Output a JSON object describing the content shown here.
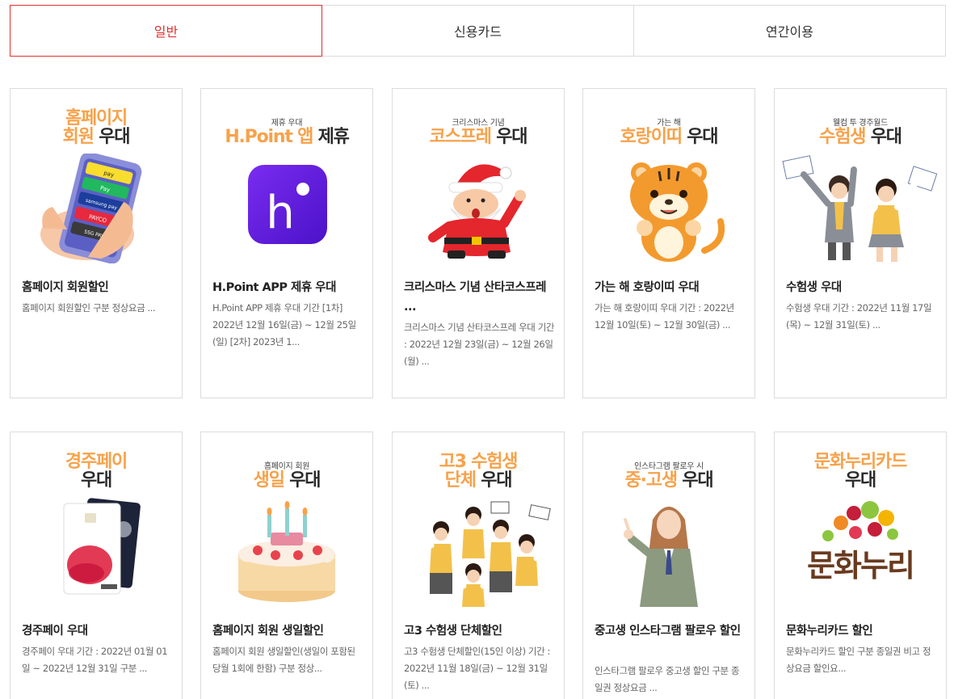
{
  "tabs": [
    {
      "label": "일반",
      "active": true
    },
    {
      "label": "신용카드",
      "active": false
    },
    {
      "label": "연간이용",
      "active": false
    }
  ],
  "colors": {
    "accent": "#e0312f",
    "poster_orange": "#f7a24a",
    "border": "#dcdcdc"
  },
  "cards": [
    {
      "poster_small": "",
      "poster_line1_orange": "홈페이지",
      "poster_line2_orange": "회원",
      "poster_line2_dark": " 우대",
      "art": "pay-phone-icon",
      "title": "홈페이지 회원할인",
      "desc": "홈페이지 회원할인 구분 정상요금 ..."
    },
    {
      "poster_small": "제휴 우대",
      "poster_line2_orange": "H.Point 앱",
      "poster_line2_dark": " 제휴",
      "art": "hpoint-app-icon",
      "title": "H.Point APP 제휴 우대",
      "desc": "H.Point APP 제휴 우대 기간 [1차] 2022년 12월 16일(금) ~ 12월 25일(일) [2차] 2023년 1..."
    },
    {
      "poster_small": "크리스마스 기념",
      "poster_line2_orange": "코스프레",
      "poster_line2_dark": " 우대",
      "art": "santa-icon",
      "title": "크리스마스 기념 산타코스프레 ...",
      "desc": "크리스마스 기념 산타코스프레 우대 기간 : 2022년 12월 23일(금) ~ 12월 26일(월) ..."
    },
    {
      "poster_small": "가는 해",
      "poster_line2_orange": "호랑이띠",
      "poster_line2_dark": " 우대",
      "art": "tiger-icon",
      "title": "가는 해 호랑이띠 우대",
      "desc": "가는 해 호랑이띠 우대 기간 : 2022년 12월 10일(토) ~ 12월 30일(금) ..."
    },
    {
      "poster_small": "웰컴 투 경주월드",
      "poster_line2_orange": "수험생",
      "poster_line2_dark": " 우대",
      "art": "students-cheer-icon",
      "title": "수험생 우대",
      "desc": "수험생 우대 기간 : 2022년 11월 17일(목) ~ 12월 31일(토) ..."
    },
    {
      "poster_small": "",
      "poster_line1_orange": "경주페이",
      "poster_line2_dark": "우대",
      "art": "gyeongju-pay-card-icon",
      "title": "경주페이 우대",
      "desc": "경주페이 우대 기간 : 2022년 01월 01일 ~ 2022년 12월 31일 구분 ..."
    },
    {
      "poster_small": "홈페이지 회원",
      "poster_line2_orange": "생일",
      "poster_line2_dark": " 우대",
      "art": "birthday-cake-icon",
      "title": "홈페이지 회원 생일할인",
      "desc": "홈페이지 회원 생일할인(생일이 포함된 당월 1회에 한함) 구분 정상..."
    },
    {
      "poster_small": "",
      "poster_line1_orange": "고3 수험생",
      "poster_line2_orange": "단체",
      "poster_line2_dark": " 우대",
      "art": "student-group-icon",
      "title": "고3 수험생 단체할인",
      "desc": "고3 수험생 단체할인(15인 이상) 기간 : 2022년 11월 18일(금) ~ 12월 31일(토) ..."
    },
    {
      "poster_small": "인스타그램 팔로우 시",
      "poster_line2_orange": "중·고생",
      "poster_line2_dark": " 우대",
      "art": "student-girl-icon",
      "title": "중고생 인스타그램 팔로우 할인",
      "desc": "인스타그램 팔로우 중고생 할인 구분 종일권 정상요금 ..."
    },
    {
      "poster_small": "",
      "poster_line1_orange": "문화누리카드",
      "poster_line2_dark": "우대",
      "art": "munhwa-nuri-logo",
      "art_text": "문화누리",
      "title": "문화누리카드 할인",
      "desc": "문화누리카드 할인 구분 종일권 비고 정상요금 할인요..."
    }
  ]
}
